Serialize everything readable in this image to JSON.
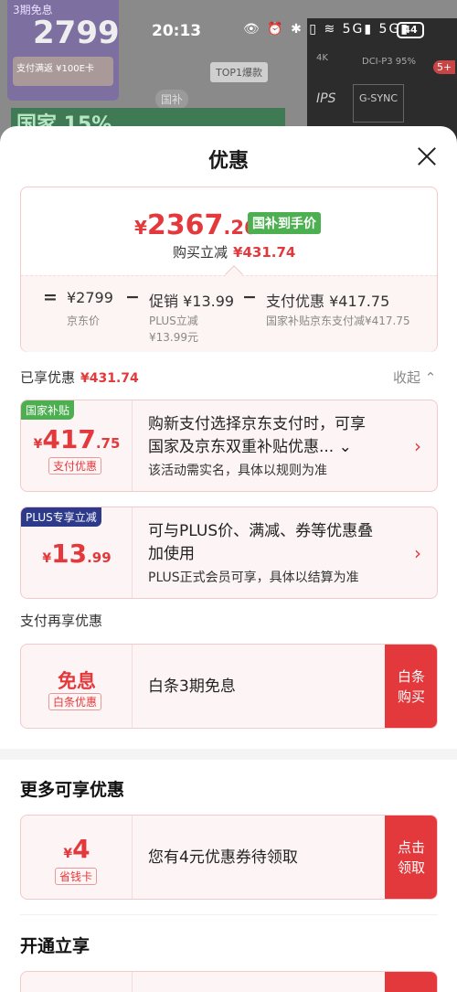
{
  "status_bar": {
    "time": "20:13",
    "signal": "👁 ⏰ ✱ ▯ ≋ 5G▮ 5G▮",
    "battery": "44"
  },
  "background": {
    "promo_tag": "3期免息",
    "promo_price": "2799",
    "promo_coupon": "支付满返 ¥100E卡",
    "top_badge": "TOP1爆款",
    "subsidy_chip": "国补",
    "banner_text": "国家 15%",
    "right_tags": [
      "4K",
      "DCI-P3 95%",
      "IPS",
      "G-SYNC"
    ],
    "right_badge": "5+"
  },
  "sheet": {
    "title": "优惠",
    "summary": {
      "currency": "¥",
      "price_int": "2367",
      "price_dec": ".26",
      "tag": "国补到手价",
      "save_label": "购买立减",
      "save_amount": "¥431.74",
      "breakdown": {
        "eq": "=",
        "jd_price": "¥2799",
        "jd_label": "京东价",
        "minus1": "−",
        "promo": "促销 ¥13.99",
        "promo_sub1": "PLUS立减",
        "promo_sub2": "¥13.99元",
        "minus2": "−",
        "pay": "支付优惠 ¥417.75",
        "pay_sub": "国家补贴京东支付减¥417.75"
      }
    },
    "enjoyed": {
      "label": "已享优惠",
      "amount": "¥431.74",
      "collapse": "收起 ⌃"
    },
    "offers": [
      {
        "corner": "国家补贴",
        "currency": "¥",
        "int": "417",
        "dec": ".75",
        "tag": "支付优惠",
        "line1": "购新支付选择京东支付时，可享",
        "line2": "国家及京东双重补贴优惠... ⌄",
        "note": "该活动需实名，具体以规则为准",
        "chevron": "›"
      },
      {
        "corner": "PLUS专享立减",
        "currency": "¥",
        "int": "13",
        "dec": ".99",
        "line1": "可与PLUS价、满减、券等优惠叠",
        "line2": "加使用",
        "note": "PLUS正式会员可享，具体以结算为准",
        "chevron": "›"
      }
    ],
    "pay_more": {
      "title": "支付再享优惠",
      "amount": "免息",
      "tag": "白条优惠",
      "desc": "白条3期免息",
      "action": "白条\n购买"
    },
    "more": {
      "title": "更多可享优惠",
      "currency": "¥",
      "int": "4",
      "tag": "省钱卡",
      "desc": "您有4元优惠券待领取",
      "action": "点击\n领取"
    },
    "open": {
      "title": "开通立享"
    }
  },
  "colors": {
    "accent": "#e4393c",
    "green": "#4caf50",
    "plus_blue": "#2d3a8c"
  }
}
